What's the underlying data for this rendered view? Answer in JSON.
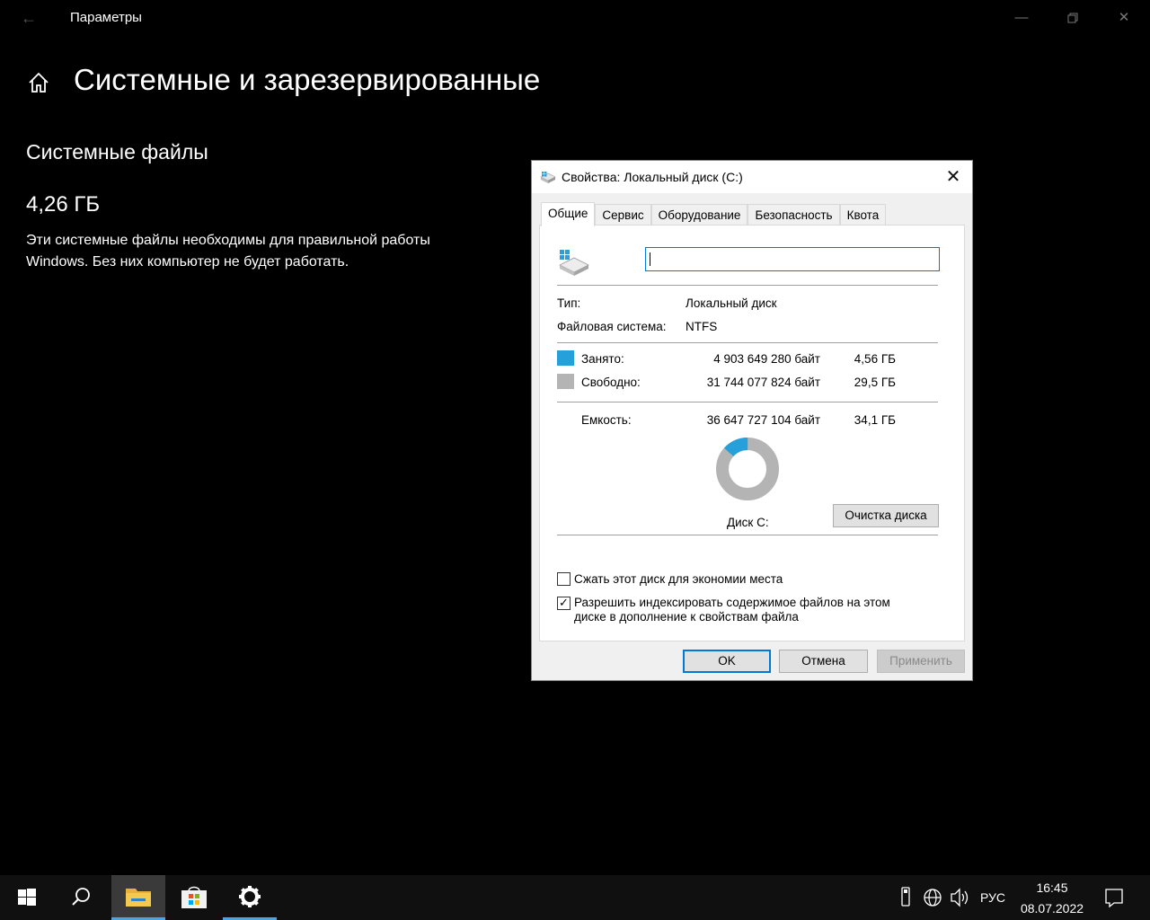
{
  "window": {
    "app_title": "Параметры",
    "back_icon": "arrow-left-icon",
    "minimize_icon": "minimize-icon",
    "maximize_icon": "restore-icon",
    "close_icon": "close-icon"
  },
  "page": {
    "title": "Системные и зарезервированные",
    "section_title": "Системные файлы",
    "size": "4,26 ГБ",
    "description": "Эти системные файлы необходимы для правильной работы Windows. Без них компьютер не будет работать."
  },
  "dialog": {
    "title": "Свойства: Локальный диск (C:)",
    "tabs": [
      "Общие",
      "Сервис",
      "Оборудование",
      "Безопасность",
      "Квота"
    ],
    "name_value": "",
    "type_label": "Тип:",
    "type_value": "Локальный диск",
    "fs_label": "Файловая система:",
    "fs_value": "NTFS",
    "used_label": "Занято:",
    "used_bytes": "4 903 649 280 байт",
    "used_gb": "4,56 ГБ",
    "free_label": "Свободно:",
    "free_bytes": "31 744 077 824 байт",
    "free_gb": "29,5 ГБ",
    "capacity_label": "Емкость:",
    "capacity_bytes": "36 647 727 104 байт",
    "capacity_gb": "34,1 ГБ",
    "used_fraction": 0.134,
    "used_color": "#26a0da",
    "free_color": "#b4b4b4",
    "disk_label": "Диск C:",
    "cleanup_button": "Очистка диска",
    "compress_label": "Сжать этот диск для экономии места",
    "compress_checked": false,
    "index_label_line1": "Разрешить индексировать содержимое файлов на этом",
    "index_label_line2": "диске в дополнение к свойствам файла",
    "index_checked": true,
    "ok_button": "OK",
    "cancel_button": "Отмена",
    "apply_button": "Применить"
  },
  "taskbar": {
    "items": [
      "start-icon",
      "search-icon",
      "file-explorer-icon",
      "store-icon",
      "settings-icon"
    ],
    "language": "РУС",
    "time": "16:45",
    "date": "08.07.2022"
  }
}
